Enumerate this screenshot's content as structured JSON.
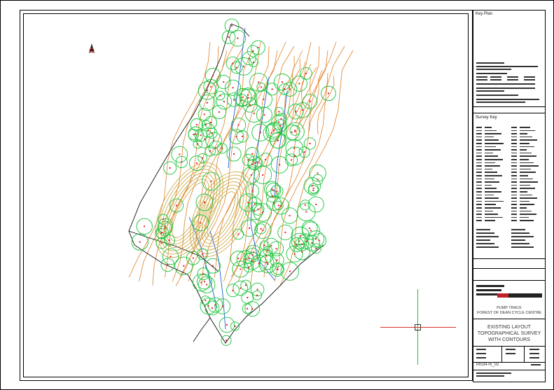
{
  "panel": {
    "key_plan_label": "Key Plan",
    "survey_key_label": "Survey Key",
    "project_line1": "PUMP TRACK",
    "project_line2": "FOREST OF DEAN CYCLE CENTRE",
    "drawing_title_line1": "EXISTING LAYOUT",
    "drawing_title_line2": "TOPOGRAPHICAL SURVEY",
    "drawing_title_line3": "WITH CONTOURS",
    "drawing_number": "MS3476_02"
  },
  "colors": {
    "tree_canopy": "#19c43a",
    "contour": "#e0812a",
    "contour_track": "#c9a23a",
    "watercourse": "#1f5fd0",
    "boundary": "#111111",
    "tree_point": "#e0202a",
    "axis_red": "#e0302a",
    "axis_green": "#19c43a",
    "logo_red": "#c0202a"
  },
  "icons": {
    "north_arrow": "north-arrow-icon",
    "cursor": "crosshair-cursor-icon"
  }
}
